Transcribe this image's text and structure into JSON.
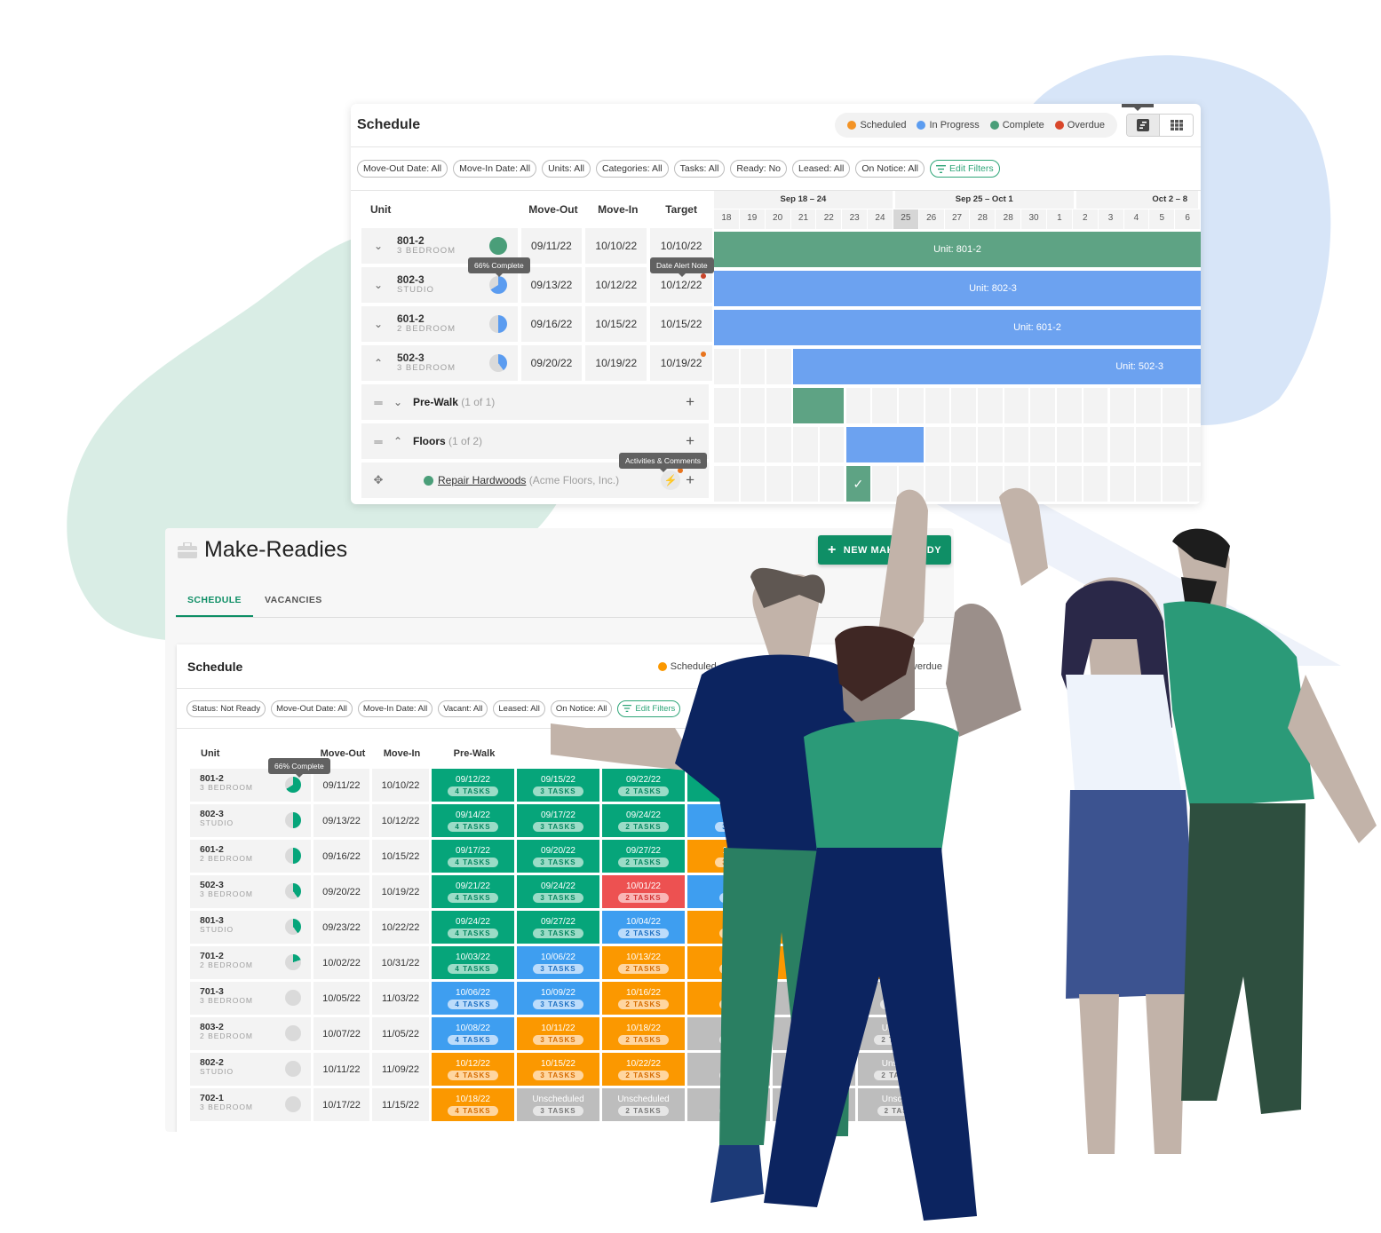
{
  "gantt": {
    "title": "Schedule",
    "legend": [
      {
        "label": "Scheduled",
        "color": "#f39325"
      },
      {
        "label": "In Progress",
        "color": "#5b9cf0"
      },
      {
        "label": "Complete",
        "color": "#4a9e79"
      },
      {
        "label": "Overdue",
        "color": "#d9472b"
      }
    ],
    "view_toggle": {
      "active": "gantt-view",
      "options": [
        "gantt-view-icon",
        "grid-view-icon"
      ]
    },
    "filters": [
      "Move-Out Date: All",
      "Move-In Date: All",
      "Units: All",
      "Categories: All",
      "Tasks: All",
      "Ready: No",
      "Leased: All",
      "On Notice: All"
    ],
    "edit_filters_label": "Edit Filters",
    "columns": {
      "unit": "Unit",
      "move_out": "Move-Out",
      "move_in": "Move-In",
      "target": "Target"
    },
    "weeks": [
      "Sep 18 – 24",
      "Sep 25 – Oct 1",
      "Oct 2 – 8"
    ],
    "days": [
      "18",
      "19",
      "20",
      "21",
      "22",
      "23",
      "24",
      "25",
      "26",
      "27",
      "28",
      "28",
      "30",
      "1",
      "2",
      "3",
      "4",
      "5",
      "6"
    ],
    "today": "25",
    "units": [
      {
        "id": "801-2",
        "type": "3 BEDROOM",
        "move_out": "09/11/22",
        "move_in": "10/10/22",
        "target": "10/10/22",
        "progress": 1.0,
        "status": "complete",
        "bar_label": "Unit: 801-2",
        "expanded": false
      },
      {
        "id": "802-3",
        "type": "STUDIO",
        "move_out": "09/13/22",
        "move_in": "10/12/22",
        "target": "10/12/22",
        "progress": 0.66,
        "status": "in-progress",
        "bar_label": "Unit: 802-3",
        "alert": "overdue",
        "expanded": false
      },
      {
        "id": "601-2",
        "type": "2 BEDROOM",
        "move_out": "09/16/22",
        "move_in": "10/15/22",
        "target": "10/15/22",
        "progress": 0.5,
        "status": "in-progress",
        "bar_label": "Unit: 601-2",
        "expanded": false
      },
      {
        "id": "502-3",
        "type": "3 BEDROOM",
        "move_out": "09/20/22",
        "move_in": "10/19/22",
        "target": "10/19/22",
        "progress": 0.4,
        "status": "in-progress",
        "bar_label": "Unit: 502-3",
        "alert": "scheduled",
        "expanded": true
      }
    ],
    "categories": [
      {
        "name": "Pre-Walk",
        "count": "(1 of 1)",
        "expanded": false
      },
      {
        "name": "Floors",
        "count": "(1 of 2)",
        "expanded": true
      }
    ],
    "task": {
      "name": "Repair Hardwoods",
      "vendor": "(Acme Floors, Inc.)",
      "status": "complete"
    },
    "tooltips": {
      "progress": "66% Complete",
      "date_alert": "Date Alert Note",
      "activities": "Activities & Comments"
    }
  },
  "make_readies": {
    "title": "Make-Readies",
    "new_button": "NEW MAKE-READY",
    "tabs": [
      {
        "label": "SCHEDULE",
        "active": true
      },
      {
        "label": "VACANCIES",
        "active": false
      }
    ],
    "schedule_title": "Schedule",
    "legend": [
      {
        "label": "Scheduled",
        "color": "#fb9800"
      },
      {
        "label": "Overdue",
        "color": "#ed5151"
      }
    ],
    "filters": [
      "Status: Not Ready",
      "Move-Out Date: All",
      "Move-In Date: All",
      "Vacant: All",
      "Leased: All",
      "On Notice: All"
    ],
    "edit_filters_label": "Edit Filters",
    "columns": {
      "unit": "Unit",
      "move_out": "Move-Out",
      "move_in": "Move-In",
      "first_category": "Pre-Walk"
    },
    "tooltip": "66% Complete",
    "rows": [
      {
        "id": "801-2",
        "type": "3 BEDROOM",
        "move_out": "09/11/22",
        "move_in": "10/10/22",
        "progress": 0.66,
        "cells": [
          {
            "date": "09/12/22",
            "tasks": "4 TASKS",
            "status": "complete"
          },
          {
            "date": "09/15/22",
            "tasks": "3 TASKS",
            "status": "complete"
          },
          {
            "date": "09/22/22",
            "tasks": "2 TASKS",
            "status": "complete"
          },
          {
            "date": "09/",
            "tasks": "3 T",
            "status": "complete"
          }
        ]
      },
      {
        "id": "802-3",
        "type": "STUDIO",
        "move_out": "09/13/22",
        "move_in": "10/12/22",
        "progress": 0.5,
        "cells": [
          {
            "date": "09/14/22",
            "tasks": "4 TASKS",
            "status": "complete"
          },
          {
            "date": "09/17/22",
            "tasks": "3 TASKS",
            "status": "complete"
          },
          {
            "date": "09/24/22",
            "tasks": "2 TASKS",
            "status": "complete"
          },
          {
            "date": "10/",
            "tasks": "3 T",
            "status": "progress"
          }
        ]
      },
      {
        "id": "601-2",
        "type": "2 BEDROOM",
        "move_out": "09/16/22",
        "move_in": "10/15/22",
        "progress": 0.5,
        "cells": [
          {
            "date": "09/17/22",
            "tasks": "4 TASKS",
            "status": "complete"
          },
          {
            "date": "09/20/22",
            "tasks": "3 TASKS",
            "status": "complete"
          },
          {
            "date": "09/27/22",
            "tasks": "2 TASKS",
            "status": "complete"
          },
          {
            "date": "10/",
            "tasks": "3 T",
            "status": "scheduled"
          }
        ]
      },
      {
        "id": "502-3",
        "type": "3 BEDROOM",
        "move_out": "09/20/22",
        "move_in": "10/19/22",
        "progress": 0.4,
        "cells": [
          {
            "date": "09/21/22",
            "tasks": "4 TASKS",
            "status": "complete"
          },
          {
            "date": "09/24/22",
            "tasks": "3 TASKS",
            "status": "complete"
          },
          {
            "date": "10/01/22",
            "tasks": "2 TASKS",
            "status": "overdue"
          },
          {
            "date": "10",
            "tasks": "3",
            "status": "progress"
          }
        ]
      },
      {
        "id": "801-3",
        "type": "STUDIO",
        "move_out": "09/23/22",
        "move_in": "10/22/22",
        "progress": 0.4,
        "cells": [
          {
            "date": "09/24/22",
            "tasks": "4 TASKS",
            "status": "complete"
          },
          {
            "date": "09/27/22",
            "tasks": "3 TASKS",
            "status": "complete"
          },
          {
            "date": "10/04/22",
            "tasks": "2 TASKS",
            "status": "progress"
          },
          {
            "date": "1",
            "tasks": "3",
            "status": "scheduled"
          }
        ]
      },
      {
        "id": "701-2",
        "type": "2 BEDROOM",
        "move_out": "10/02/22",
        "move_in": "10/31/22",
        "progress": 0.2,
        "cells": [
          {
            "date": "10/03/22",
            "tasks": "4 TASKS",
            "status": "complete"
          },
          {
            "date": "10/06/22",
            "tasks": "3 TASKS",
            "status": "progress"
          },
          {
            "date": "10/13/22",
            "tasks": "2 TASKS",
            "status": "scheduled"
          },
          {
            "date": "1",
            "tasks": "3",
            "status": "scheduled"
          }
        ]
      },
      {
        "id": "701-3",
        "type": "3 BEDROOM",
        "move_out": "10/05/22",
        "move_in": "11/03/22",
        "progress": 0,
        "cells": [
          {
            "date": "10/06/22",
            "tasks": "4 TASKS",
            "status": "progress"
          },
          {
            "date": "10/09/22",
            "tasks": "3 TASKS",
            "status": "progress"
          },
          {
            "date": "10/16/22",
            "tasks": "2 TASKS",
            "status": "scheduled"
          },
          {
            "date": "1",
            "tasks": "3",
            "status": "scheduled"
          }
        ]
      },
      {
        "id": "803-2",
        "type": "2 BEDROOM",
        "move_out": "10/07/22",
        "move_in": "11/05/22",
        "progress": 0,
        "cells": [
          {
            "date": "10/08/22",
            "tasks": "4 TASKS",
            "status": "progress"
          },
          {
            "date": "10/11/22",
            "tasks": "3 TASKS",
            "status": "scheduled"
          },
          {
            "date": "10/18/22",
            "tasks": "2 TASKS",
            "status": "scheduled"
          },
          {
            "date": "Un",
            "tasks": "3",
            "status": "unscheduled"
          }
        ]
      },
      {
        "id": "802-2",
        "type": "STUDIO",
        "move_out": "10/11/22",
        "move_in": "11/09/22",
        "progress": 0,
        "cells": [
          {
            "date": "10/12/22",
            "tasks": "4 TASKS",
            "status": "scheduled"
          },
          {
            "date": "10/15/22",
            "tasks": "3 TASKS",
            "status": "scheduled"
          },
          {
            "date": "10/22/22",
            "tasks": "2 TASKS",
            "status": "scheduled"
          },
          {
            "date": "Un",
            "tasks": "3",
            "status": "unscheduled"
          }
        ]
      },
      {
        "id": "702-1",
        "type": "3 BEDROOM",
        "move_out": "10/17/22",
        "move_in": "11/15/22",
        "progress": 0,
        "cells": [
          {
            "date": "10/18/22",
            "tasks": "4 TASKS",
            "status": "scheduled"
          },
          {
            "date": "Unscheduled",
            "tasks": "3 TASKS",
            "status": "unscheduled"
          },
          {
            "date": "Unscheduled",
            "tasks": "2 TASKS",
            "status": "unscheduled"
          },
          {
            "date": "Uns",
            "tasks": "3",
            "status": "unscheduled"
          }
        ]
      }
    ],
    "right_column_cells": [
      {
        "date": "Unsched",
        "tasks": "2 TAS"
      },
      {
        "date": "Unsched",
        "tasks": "2 TASKS"
      },
      {
        "date": "Unsched",
        "tasks": "2 TASKS"
      },
      {
        "date": "Unsched",
        "tasks": "2 TASK"
      }
    ]
  }
}
